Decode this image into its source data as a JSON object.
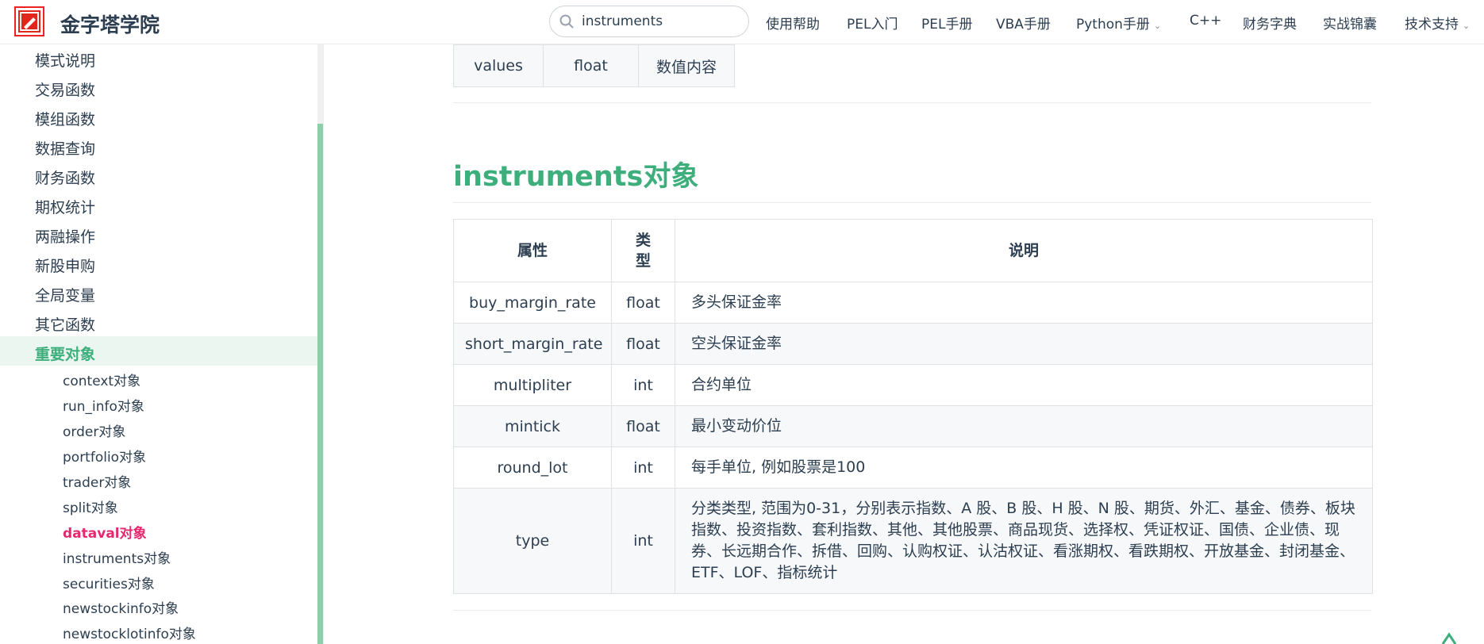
{
  "header": {
    "site_name": "金字塔学院",
    "search_value": "instruments",
    "nav": [
      {
        "label": "使用帮助"
      },
      {
        "label": "PEL入门"
      },
      {
        "label": "PEL手册"
      },
      {
        "label": "VBA手册"
      },
      {
        "label": "Python手册",
        "has_dropdown": true
      },
      {
        "label": "C++"
      },
      {
        "label": "财务字典"
      },
      {
        "label": "实战锦囊"
      },
      {
        "label": "技术支持",
        "has_dropdown": true
      }
    ]
  },
  "sidebar": {
    "items": [
      {
        "label": "模式说明"
      },
      {
        "label": "交易函数"
      },
      {
        "label": "模组函数"
      },
      {
        "label": "数据查询"
      },
      {
        "label": "财务函数"
      },
      {
        "label": "期权统计"
      },
      {
        "label": "两融操作"
      },
      {
        "label": "新股申购"
      },
      {
        "label": "全局变量"
      },
      {
        "label": "其它函数"
      },
      {
        "label": "重要对象",
        "active": true
      }
    ],
    "subitems": [
      {
        "label": "context对象"
      },
      {
        "label": "run_info对象"
      },
      {
        "label": "order对象"
      },
      {
        "label": "portfolio对象"
      },
      {
        "label": "trader对象"
      },
      {
        "label": "split对象"
      },
      {
        "label": "dataval对象",
        "current": true
      },
      {
        "label": "instruments对象"
      },
      {
        "label": "securities对象"
      },
      {
        "label": "newstockinfo对象"
      },
      {
        "label": "newstocklotinfo对象"
      }
    ]
  },
  "main": {
    "top_row": {
      "name": "values",
      "type": "float",
      "desc": "数值内容"
    },
    "section_title": "instruments对象",
    "table": {
      "headers": {
        "attr": "属性",
        "type": "类\n型",
        "desc": "说明"
      },
      "rows": [
        {
          "name": "buy_margin_rate",
          "type": "float",
          "desc": "多头保证金率"
        },
        {
          "name": "short_margin_rate",
          "type": "float",
          "desc": "空头保证金率"
        },
        {
          "name": "multipliter",
          "type": "int",
          "desc": "合约单位"
        },
        {
          "name": "mintick",
          "type": "float",
          "desc": "最小变动价位"
        },
        {
          "name": "round_lot",
          "type": "int",
          "desc": "每手单位, 例如股票是100"
        },
        {
          "name": "type",
          "type": "int",
          "desc": "分类类型, 范围为0-31，分别表示指数、A 股、B 股、H 股、N 股、期货、外汇、基金、债券、板块指数、投资指数、套利指数、其他、其他股票、商品现货、选择权、凭证权证、国债、企业债、现券、长远期合作、拆借、回购、认购权证、认沽权证、看涨期权、看跌期权、开放基金、封闭基金、ETF、LOF、指标统计"
        }
      ]
    }
  },
  "colors": {
    "accent": "#3eaf7c",
    "current_link": "#e6286e",
    "logo_red": "#e3261b"
  }
}
